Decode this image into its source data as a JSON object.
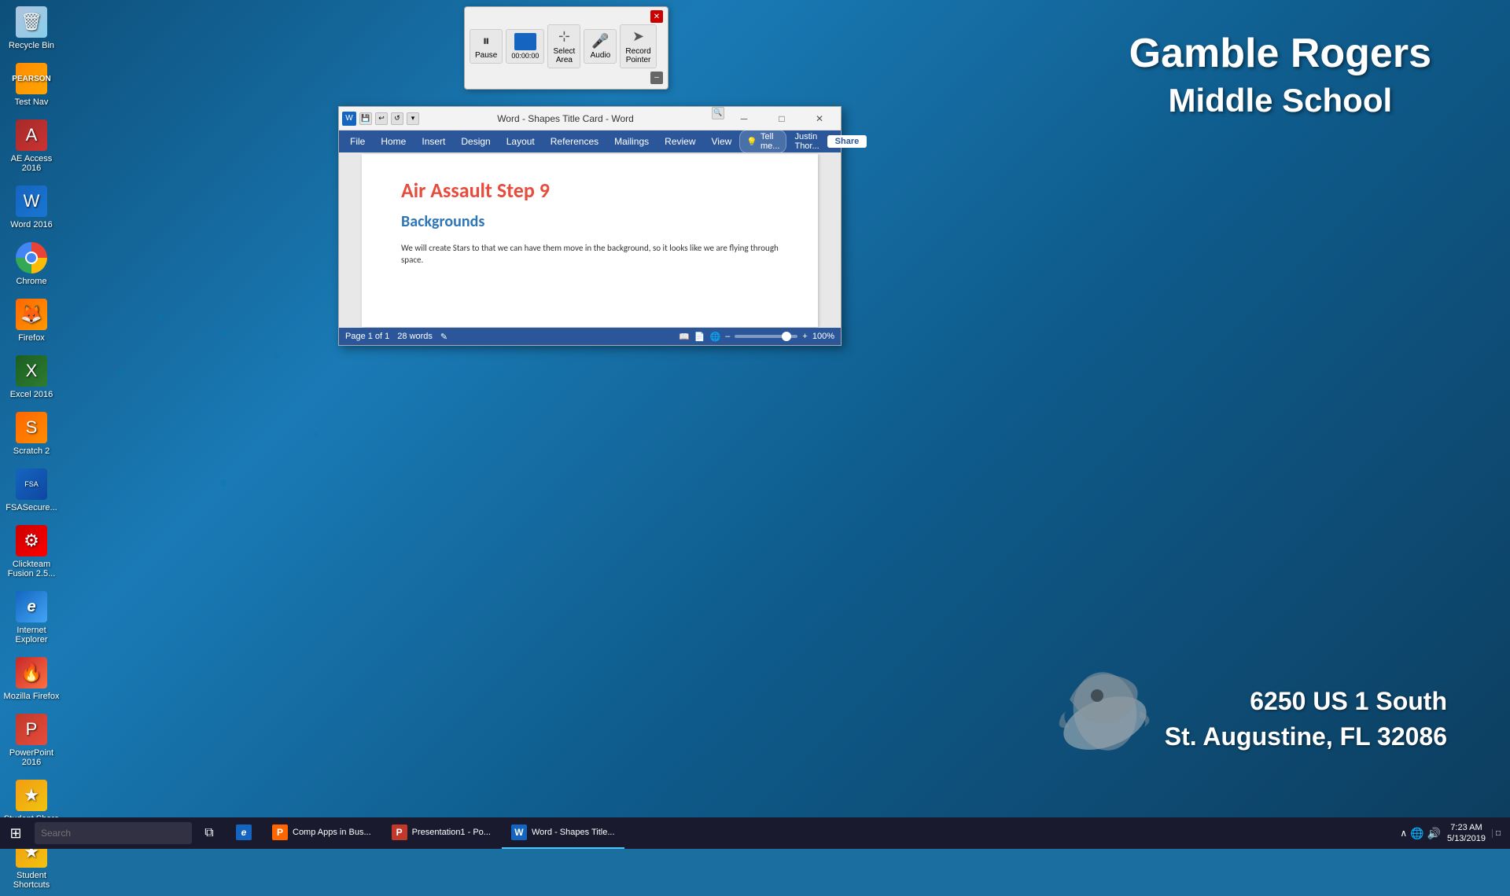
{
  "desktop": {
    "bg_color": "#0e5a8a",
    "school_name_line1": "Gamble Rogers",
    "school_name_line2": "Middle School",
    "school_address_line1": "6250 US 1 South",
    "school_address_line2": "St. Augustine, FL 32086"
  },
  "icons": [
    {
      "id": "recycle-bin",
      "label": "Recycle Bin",
      "style": "recycle"
    },
    {
      "id": "test-nav",
      "label": "Test Nav",
      "style": "testNav",
      "symbol": "P"
    },
    {
      "id": "access-2016",
      "label": "AE Access 2016",
      "style": "access",
      "symbol": "A"
    },
    {
      "id": "word-2016",
      "label": "Word 2016",
      "style": "word",
      "symbol": "W"
    },
    {
      "id": "chrome",
      "label": "Chrome",
      "style": "chrome"
    },
    {
      "id": "firefox",
      "label": "Firefox",
      "style": "firefox",
      "symbol": "🦊"
    },
    {
      "id": "excel-2016",
      "label": "Excel 2016",
      "style": "excel",
      "symbol": "X"
    },
    {
      "id": "scratch-2",
      "label": "Scratch 2",
      "style": "scratch",
      "symbol": "S"
    },
    {
      "id": "fsa-secure",
      "label": "FSASecure...",
      "style": "fsa",
      "symbol": "FSA"
    },
    {
      "id": "clickteam",
      "label": "Clickteam Fusion 2.5...",
      "style": "clickteam",
      "symbol": "⚙"
    },
    {
      "id": "ie",
      "label": "Internet Explorer",
      "style": "ie",
      "symbol": "e"
    },
    {
      "id": "mozilla-firefox",
      "label": "Mozilla Firefox",
      "style": "mozilla",
      "symbol": "🔥"
    },
    {
      "id": "powerpoint-2016",
      "label": "PowerPoint 2016",
      "style": "ppt",
      "symbol": "P"
    },
    {
      "id": "student-share",
      "label": "Student Share",
      "style": "student-share",
      "symbol": "★"
    },
    {
      "id": "student-shortcuts",
      "label": "Student Shortcuts",
      "style": "student-shortcuts",
      "symbol": "★"
    }
  ],
  "recording_toolbar": {
    "pause_label": "Pause",
    "timer_label": "00:00:00",
    "select_label": "Select\nArea",
    "audio_label": "Audio",
    "pointer_label": "Record\nPointer"
  },
  "word_window": {
    "title": "Word - Shapes Title Card - Word",
    "menus": [
      "File",
      "Home",
      "Insert",
      "Design",
      "Layout",
      "References",
      "Mailings",
      "Review",
      "View"
    ],
    "tell_me": "Tell me...",
    "user": "Justin Thor...",
    "share": "Share",
    "doc_title": "Air Assault Step 9",
    "doc_subtitle": "Backgrounds",
    "doc_body": "We will create Stars to that we can have them move in the background, so it looks like we are flying through space.",
    "status_page": "Page 1 of 1",
    "status_words": "28 words",
    "zoom_level": "100%"
  },
  "taskbar": {
    "start_icon": "⊞",
    "search_placeholder": "Search",
    "items": [
      {
        "id": "comp-apps",
        "label": "Comp Apps in Bus...",
        "icon_color": "#ff6600",
        "icon_symbol": "P",
        "active": false
      },
      {
        "id": "presentation",
        "label": "Presentation1 - Po...",
        "icon_color": "#c0392b",
        "icon_symbol": "P",
        "active": false
      },
      {
        "id": "word-shapes",
        "label": "Word - Shapes Title...",
        "icon_color": "#1565c0",
        "icon_symbol": "W",
        "active": true
      }
    ],
    "time": "7:23 AM",
    "date": "5/13/2019"
  }
}
